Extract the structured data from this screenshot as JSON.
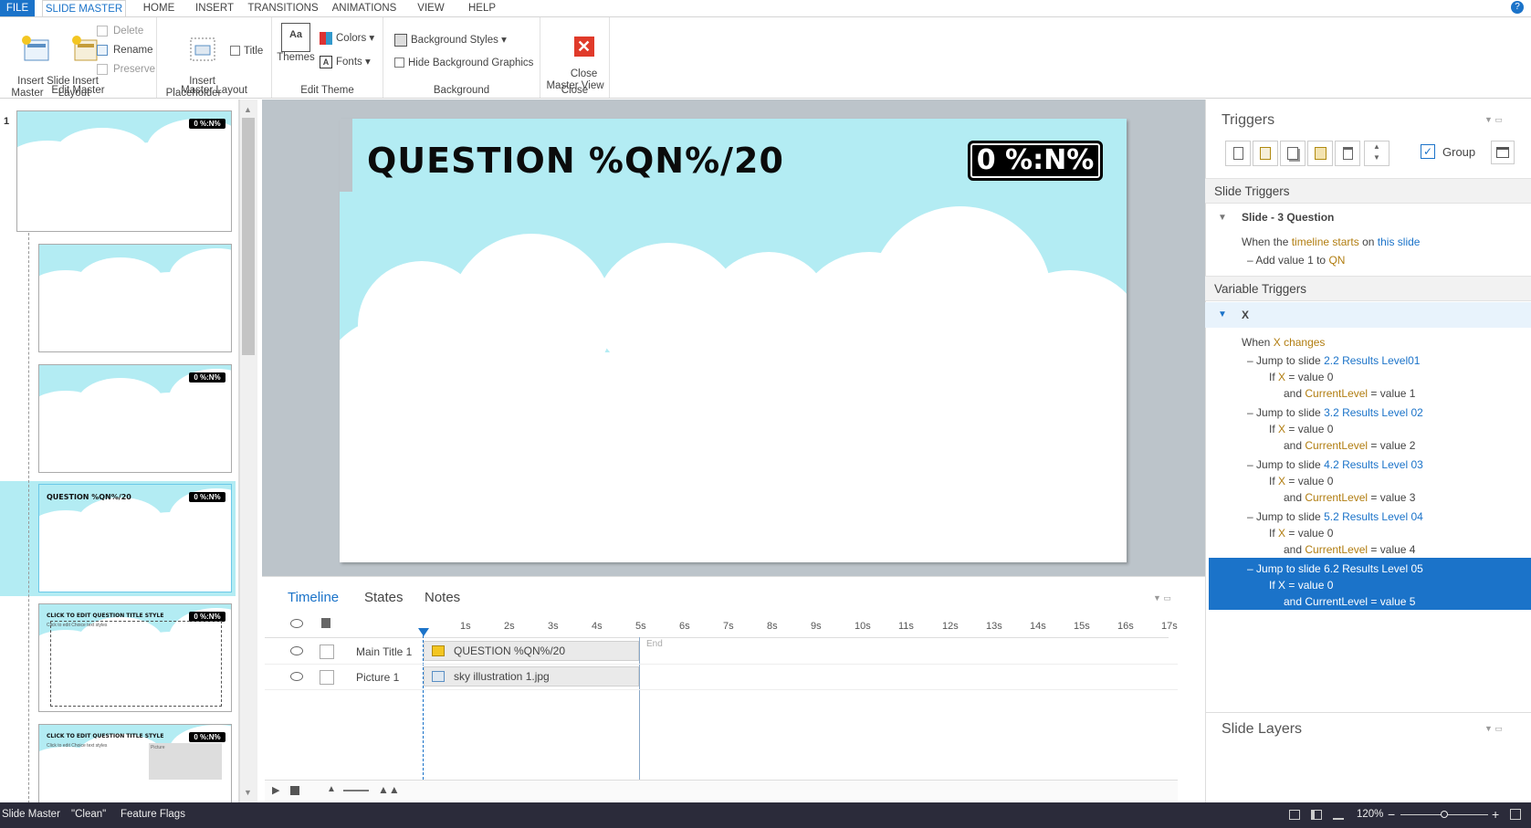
{
  "tabs": [
    "FILE",
    "SLIDE MASTER",
    "HOME",
    "INSERT",
    "TRANSITIONS",
    "ANIMATIONS",
    "VIEW",
    "HELP"
  ],
  "help": "?",
  "ribbon": {
    "edit_master": {
      "label": "Edit Master",
      "insert_slide_master": "Insert Slide\nMaster",
      "insert_layout": "Insert\nLayout",
      "delete": "Delete",
      "rename": "Rename",
      "preserve": "Preserve"
    },
    "master_layout": {
      "label": "Master Layout",
      "insert_placeholder": "Insert\nPlaceholder",
      "title": "Title"
    },
    "edit_theme": {
      "label": "Edit Theme",
      "themes": "Themes",
      "colors": "Colors",
      "fonts": "Fonts"
    },
    "background": {
      "label": "Background",
      "background_styles": "Background Styles",
      "hide_bg_graphics": "Hide Background Graphics"
    },
    "close": {
      "label": "Close",
      "close_master_view": "Close\nMaster View"
    }
  },
  "thumbs": {
    "index": "1",
    "title_small": "QUESTION %QN%/20",
    "badge_small": "0 %:N%",
    "layout_title": "CLICK TO EDIT QUESTION TITLE STYLE",
    "layout_sub": "Click to edit Choice text styles",
    "picture": "Picture"
  },
  "slide": {
    "title": "QUESTION %QN%/20",
    "badge": "0 %:N%"
  },
  "timeline": {
    "tabs": [
      "Timeline",
      "States",
      "Notes"
    ],
    "ticks": [
      "1s",
      "2s",
      "3s",
      "4s",
      "5s",
      "6s",
      "7s",
      "8s",
      "9s",
      "10s",
      "11s",
      "12s",
      "13s",
      "14s",
      "15s",
      "16s",
      "17s"
    ],
    "end": "End",
    "rows": [
      {
        "name": "Main Title 1",
        "bar": "QUESTION %QN%/20"
      },
      {
        "name": "Picture 1",
        "bar": "sky illustration 1.jpg"
      }
    ]
  },
  "triggers": {
    "title": "Triggers",
    "group": "Group",
    "slide_triggers": "Slide Triggers",
    "slide_name": "Slide - 3 Question",
    "when": "When the",
    "timeline_starts": "timeline starts",
    "on": "on",
    "this_slide": "this slide",
    "add_value": "Add value 1 to",
    "qn": "QN",
    "variable_triggers": "Variable Triggers",
    "var_x": "X",
    "when_x": "When",
    "changes": "changes",
    "jumps": [
      {
        "target": "2.2 Results Level01",
        "level": "value 1"
      },
      {
        "target": "3.2 Results Level 02",
        "level": "value 2"
      },
      {
        "target": "4.2 Results Level 03",
        "level": "value 3"
      },
      {
        "target": "5.2 Results Level 04",
        "level": "value 4"
      },
      {
        "target": "6.2 Results Level 05",
        "level": "value 5"
      }
    ],
    "jump_prefix": "Jump to slide",
    "if": "If",
    "eq_value0": "= value 0",
    "and": "and",
    "current_level": "CurrentLevel",
    "eq": "=",
    "slide_layers": "Slide Layers"
  },
  "status": {
    "mode": "Slide Master",
    "theme": "\"Clean\"",
    "flags": "Feature Flags",
    "zoom": "120%"
  }
}
